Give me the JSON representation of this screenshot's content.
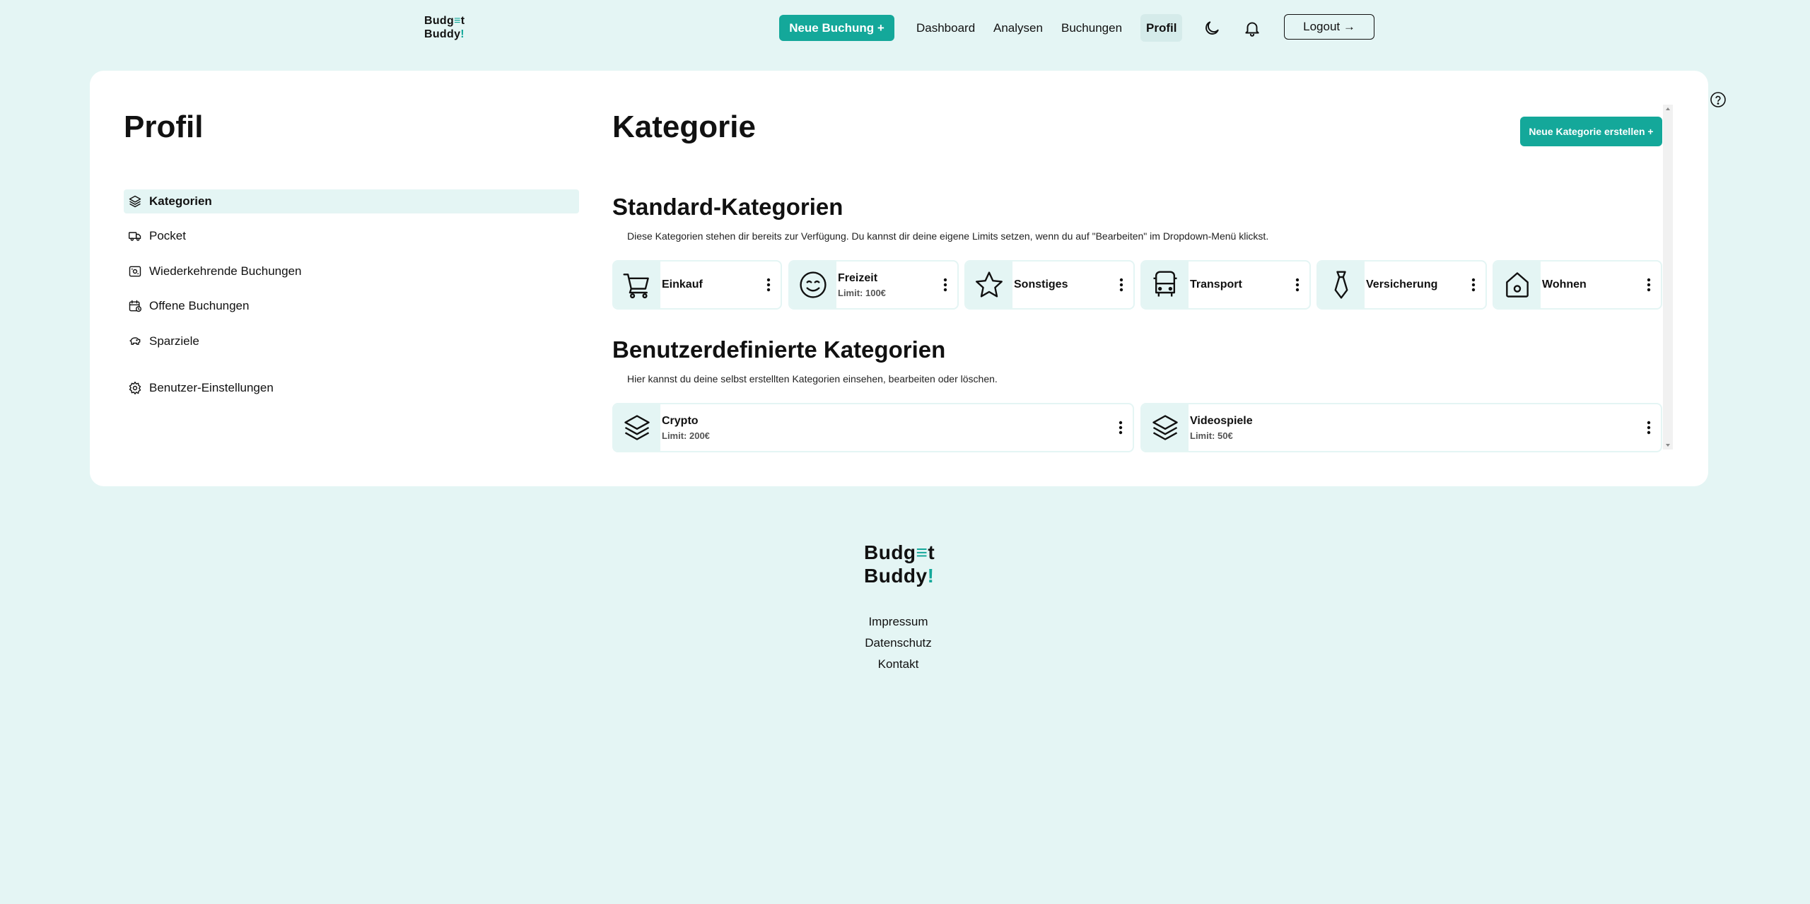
{
  "nav": {
    "logo_line1_a": "Budg",
    "logo_line1_acc": "≡",
    "logo_line1_b": "t",
    "logo_line2_a": "Buddy",
    "logo_line2_acc": "!",
    "new_booking": "Neue Buchung +",
    "links": [
      "Dashboard",
      "Analysen",
      "Buchungen",
      "Profil"
    ],
    "logout": "Logout →",
    "icons": [
      "moon-icon",
      "bell-icon"
    ]
  },
  "sidebar": {
    "title": "Profil",
    "items": [
      {
        "label": "Kategorien",
        "icon": "layers-icon",
        "active": true
      },
      {
        "label": "Pocket",
        "icon": "truck-icon"
      },
      {
        "label": "Wiederkehrende Buchungen",
        "icon": "recurring-icon"
      },
      {
        "label": "Offene Buchungen",
        "icon": "calendar-clock-icon"
      },
      {
        "label": "Sparziele",
        "icon": "piggy-bank-icon"
      },
      {
        "label": "Benutzer-Einstellungen",
        "icon": "gear-icon"
      }
    ]
  },
  "main": {
    "title": "Kategorie",
    "new_category": "Neue Kategorie erstellen +",
    "standard": {
      "title": "Standard-Kategorien",
      "desc": "Diese Kategorien stehen dir bereits zur Verfügung. Du kannst dir deine eigene Limits setzen, wenn du auf \"Bearbeiten\" im Dropdown-Menü klickst.",
      "items": [
        {
          "name": "Einkauf",
          "limit": "",
          "icon": "cart-icon"
        },
        {
          "name": "Freizeit",
          "limit": "Limit: 100€",
          "icon": "smile-icon"
        },
        {
          "name": "Sonstiges",
          "limit": "",
          "icon": "star-icon"
        },
        {
          "name": "Transport",
          "limit": "",
          "icon": "bus-icon"
        },
        {
          "name": "Versicherung",
          "limit": "",
          "icon": "tie-icon"
        },
        {
          "name": "Wohnen",
          "limit": "",
          "icon": "home-icon"
        }
      ]
    },
    "custom": {
      "title": "Benutzerdefinierte Kategorien",
      "desc": "Hier kannst du deine selbst erstellten Kategorien einsehen, bearbeiten oder löschen.",
      "items": [
        {
          "name": "Crypto",
          "limit": "Limit: 200€",
          "icon": "layers-icon"
        },
        {
          "name": "Videospiele",
          "limit": "Limit: 50€",
          "icon": "layers-icon"
        }
      ]
    }
  },
  "footer": {
    "links": [
      "Impressum",
      "Datenschutz",
      "Kontakt"
    ]
  },
  "colors": {
    "background": "#e4f5f4",
    "accent": "#14a89a",
    "card": "#ffffff"
  }
}
